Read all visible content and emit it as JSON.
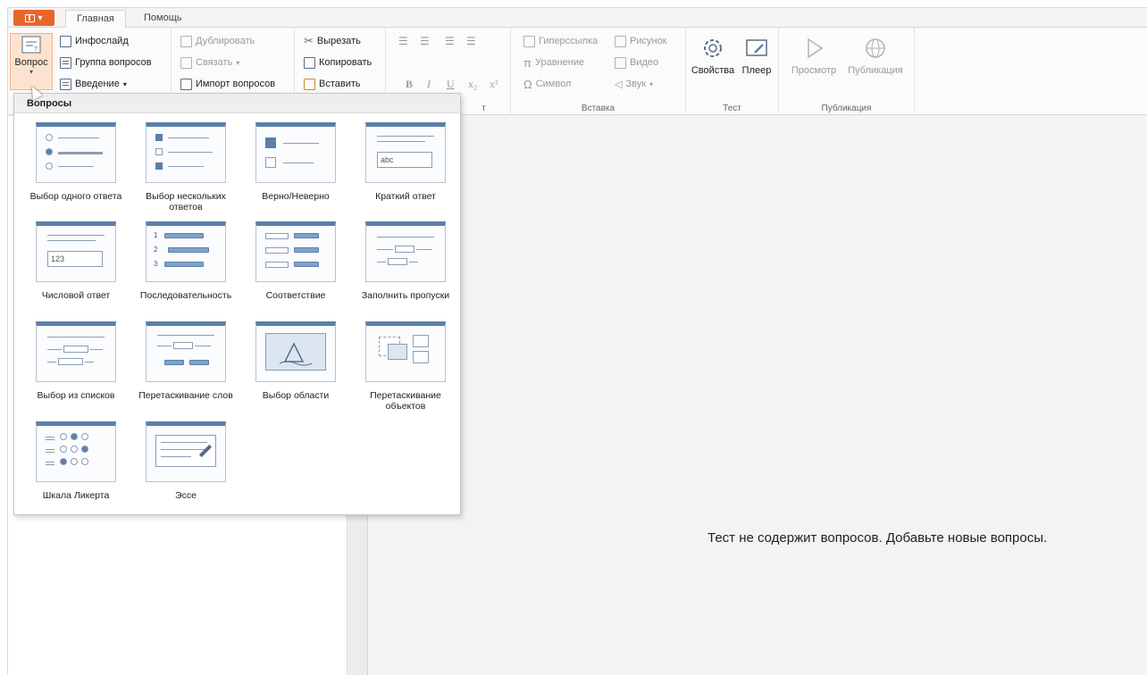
{
  "tabs": {
    "file_label": "",
    "home": "Главная",
    "help": "Помощь"
  },
  "ribbon": {
    "question_button": "Вопрос",
    "infoslide": "Инфослайд",
    "question_group": "Группа вопросов",
    "intro": "Введение",
    "duplicate": "Дублировать",
    "link": "Связать",
    "import_questions": "Импорт вопросов",
    "cut": "Вырезать",
    "copy": "Копировать",
    "paste": "Вставить",
    "hyperlink": "Гиперссылка",
    "equation": "Уравнение",
    "symbol": "Символ",
    "picture": "Рисунок",
    "video": "Видео",
    "sound": "Звук",
    "properties": "Свойства",
    "player": "Плеер",
    "preview": "Просмотр",
    "publish": "Публикация",
    "group_text_fragment": "т",
    "group_insert": "Вставка",
    "group_test": "Тест",
    "group_publish": "Публикация"
  },
  "dropdown": {
    "header": "Вопросы",
    "items": [
      {
        "label": "Выбор одного ответа"
      },
      {
        "label": "Выбор нескольких ответов"
      },
      {
        "label": "Верно/Неверно"
      },
      {
        "label": "Краткий ответ"
      },
      {
        "label": "Числовой ответ"
      },
      {
        "label": "Последовательность"
      },
      {
        "label": "Соответствие"
      },
      {
        "label": "Заполнить пропуски"
      },
      {
        "label": "Выбор из списков"
      },
      {
        "label": "Перетаскивание слов"
      },
      {
        "label": "Выбор области"
      },
      {
        "label": "Перетаскивание объектов"
      },
      {
        "label": "Шкала Ликерта"
      },
      {
        "label": "Эссе"
      }
    ],
    "short_answer_sample": "abc",
    "numeric_sample": "123",
    "sequence_numbers": [
      "1",
      "2",
      "3"
    ]
  },
  "workspace": {
    "empty_message": "Тест не содержит вопросов. Добавьте новые вопросы."
  },
  "colors": {
    "file_button": "#e8662a",
    "thumb_header": "#5b7fa8"
  }
}
